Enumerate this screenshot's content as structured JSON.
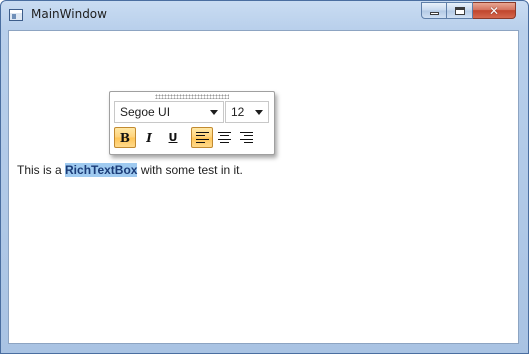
{
  "window": {
    "title": "MainWindow",
    "close_glyph": "✕"
  },
  "toolbar": {
    "font_family": "Segoe UI",
    "font_size": "12",
    "bold_label": "B",
    "italic_label": "I",
    "underline_label": "U",
    "active_buttons": [
      "bold",
      "align-left"
    ]
  },
  "document": {
    "text_before": "This is a ",
    "selected_text": "RichTextBox",
    "text_after": " with some test in it."
  },
  "icons": {
    "app": "window-app-icon",
    "minimize": "minimize-icon",
    "maximize": "maximize-icon",
    "close": "close-icon",
    "grip": "grip-icon",
    "font_dropdown": "chevron-down-icon",
    "size_dropdown": "chevron-down-icon",
    "align_left": "align-left-icon",
    "align_center": "align-center-icon",
    "align_right": "align-right-icon"
  },
  "colors": {
    "selection": "#9fcaf0",
    "active_button": "#ffd27a",
    "close_button": "#c0452c"
  }
}
